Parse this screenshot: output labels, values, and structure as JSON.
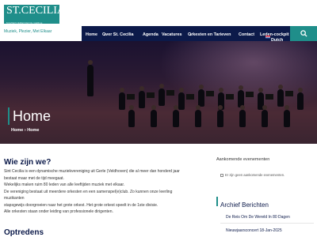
{
  "site": {
    "logo_text": "ST.CECILIA",
    "logo_sub": "MUZIEKVERENIGING GERLE",
    "tagline": "Muziek, Plezier, Met Elkaar"
  },
  "nav": {
    "items": [
      {
        "label": "Home"
      },
      {
        "label": "Over St. Cecilia"
      },
      {
        "label": "Agenda"
      },
      {
        "label": "Vacatures"
      },
      {
        "label": "Orkesten en Tarieven"
      },
      {
        "label": "Contact"
      },
      {
        "label": "Leden-cockpit"
      }
    ],
    "language": "Dutch"
  },
  "hero": {
    "title": "Home",
    "breadcrumb": [
      "Home",
      "Home"
    ]
  },
  "main": {
    "heading": "Wie zijn we?",
    "lines": [
      "Sint Cecilia is een dynamische muziekvereniging uit Gerle (Veldhoven) die al meer dan honderd jaar",
      "bestaat maar met de tijd meegaat.",
      "Wekelijks maken ruim 80 leden van alle leeftijden muziek met elkaar.",
      "De vereniging bestaat uit meerdere orkesten en een samenspel(e)club. Zo kunnen onze leerling",
      "muzikanten",
      "stapsgewijs doorgroeien naar het grote orkest. Het grote orkest speelt in de 1ste divisie.",
      "Alle orkesten staan onder leiding van professionele dirigenten."
    ],
    "next_heading": "Optredens"
  },
  "sidebar": {
    "events_heading": "Aankomende evenementen",
    "no_events": "Er zijn geen aankomende evenementen.",
    "archive_heading": "Archief Berichten",
    "archive_items": [
      "De Reis Om De Wereld In 80 Dagen",
      "Nieuwjaarsconcert 18-Jan-2025"
    ]
  },
  "colors": {
    "accent": "#1f8e8a",
    "navy": "#0c1a4a"
  },
  "icons": {
    "search": "search-icon",
    "flag": "netherlands-flag-icon"
  }
}
